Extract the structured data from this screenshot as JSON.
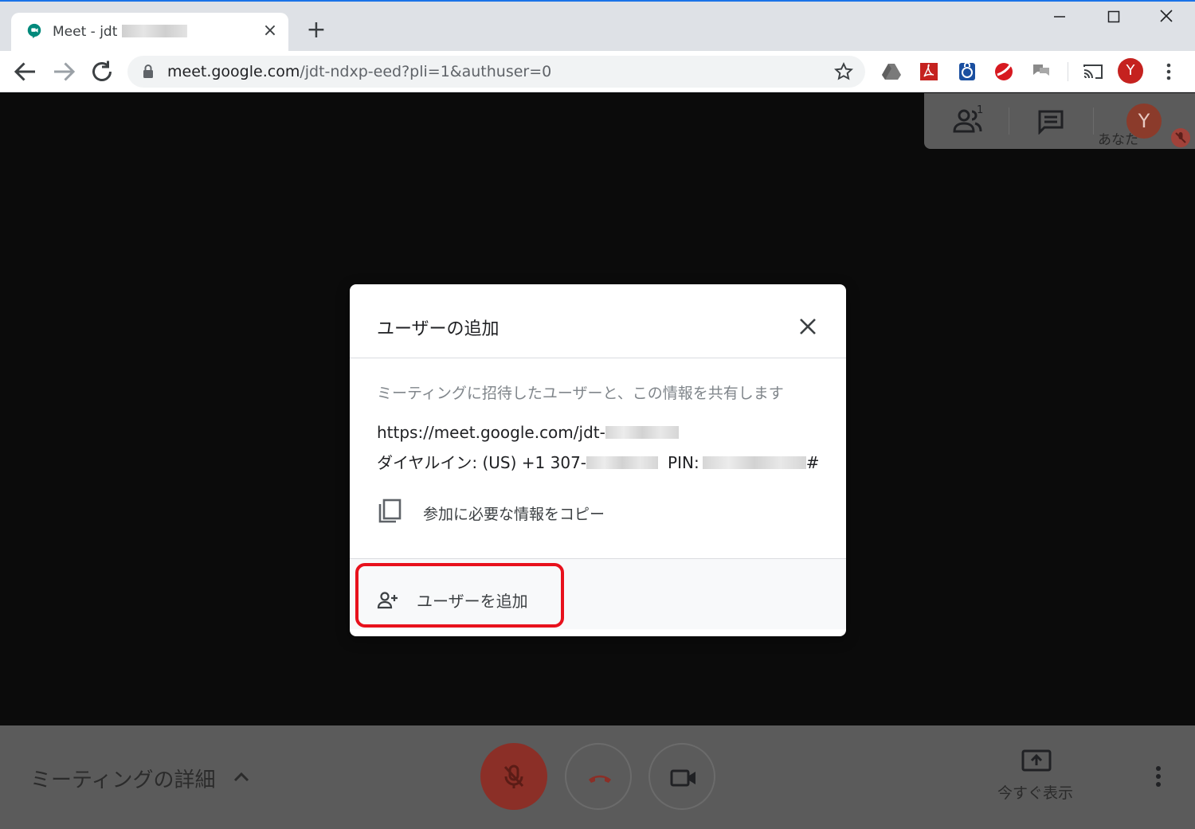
{
  "browser": {
    "tab_title": "Meet - jdt",
    "url_host": "meet.google.com",
    "url_rest": "/jdt-ndxp-eed?pli=1&authuser=0",
    "profile_initial": "Y"
  },
  "meet": {
    "participants_count": "1",
    "self_initial": "Y",
    "self_label": "あなた",
    "meeting_details_label": "ミーティングの詳細",
    "present_now_label": "今すぐ表示"
  },
  "dialog": {
    "title": "ユーザーの追加",
    "description": "ミーティングに招待したユーザーと、この情報を共有します",
    "meeting_link": "https://meet.google.com/jdt-",
    "dial_in_prefix": "ダイヤルイン: (US) +1 307-",
    "pin_label": "PIN:",
    "pin_suffix": "#",
    "copy_label": "参加に必要な情報をコピー",
    "add_user_label": "ユーザーを追加"
  },
  "colors": {
    "accent_blue": "#1a73e8",
    "mic_off_red": "#8b2f27",
    "highlight_red": "#e8111c"
  }
}
